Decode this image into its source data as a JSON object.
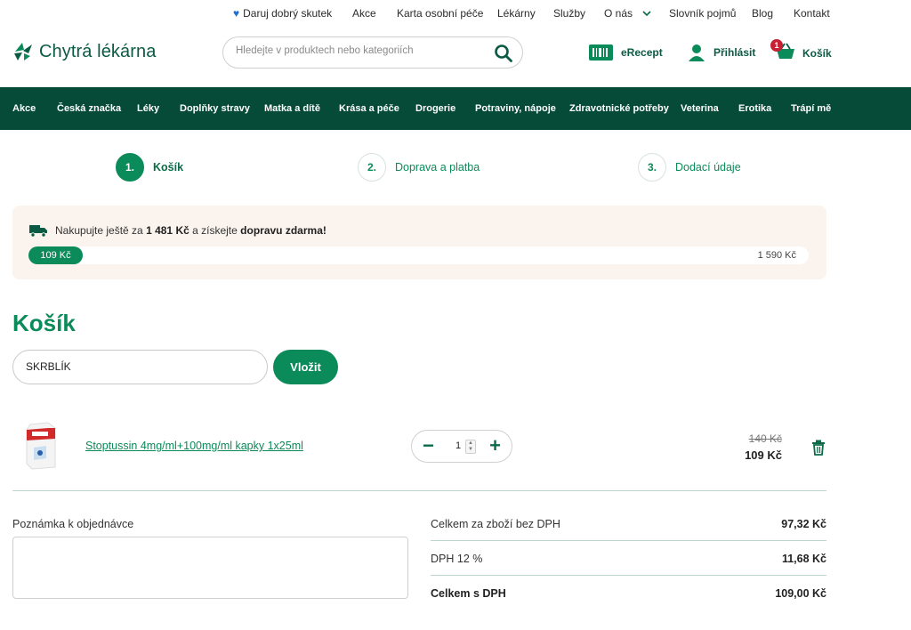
{
  "toplinks": {
    "donate": "Daruj dobrý skutek",
    "akce": "Akce",
    "karta": "Karta osobní péče",
    "lekarny": "Lékárny",
    "sluzby": "Služby",
    "onas": "O nás",
    "slovnik": "Slovník pojmů",
    "blog": "Blog",
    "kontakt": "Kontakt"
  },
  "header": {
    "logo": "Chytrá lékárna",
    "search_placeholder": "Hledejte v produktech nebo kategoriích",
    "erecept": "eRecept",
    "login": "Přihlásit",
    "cart": "Košík",
    "cart_count": "1"
  },
  "nav": {
    "items": [
      "Akce",
      "Česká značka",
      "Léky",
      "Doplňky stravy",
      "Matka a dítě",
      "Krása a péče",
      "Drogerie",
      "Potraviny, nápoje",
      "Zdravotnické potřeby",
      "Veterina",
      "Erotika",
      "Trápí mě"
    ]
  },
  "steps": [
    {
      "num": "1.",
      "label": "Košík"
    },
    {
      "num": "2.",
      "label": "Doprava a platba"
    },
    {
      "num": "3.",
      "label": "Dodací údaje"
    }
  ],
  "shipping": {
    "prefix": "Nakupujte ještě za",
    "amount": "1 481 Kč",
    "middle": "a získejte",
    "free": "dopravu zdarma!",
    "current": "109 Kč",
    "target": "1 590 Kč",
    "progress_fraction": 0.069
  },
  "cart": {
    "title": "Košík",
    "coupon_value": "SKRBLÍK",
    "coupon_button": "Vložit",
    "items": [
      {
        "name": "Stoptussin 4mg/ml+100mg/ml kapky 1x25ml",
        "qty": "1",
        "old_price": "140 Kč",
        "price": "109 Kč"
      }
    ]
  },
  "order": {
    "note_label": "Poznámka k objednávce",
    "rows": [
      {
        "label": "Celkem za zboží bez DPH",
        "value": "97,32 Kč"
      },
      {
        "label": "DPH 12 %",
        "value": "11,68 Kč"
      },
      {
        "label": "Celkem s DPH",
        "value": "109,00 Kč"
      }
    ]
  },
  "colors": {
    "primary": "#0b8a5a",
    "nav_bg": "#064b37",
    "ship_bg": "#fbf4ee",
    "badge": "#c62035"
  }
}
